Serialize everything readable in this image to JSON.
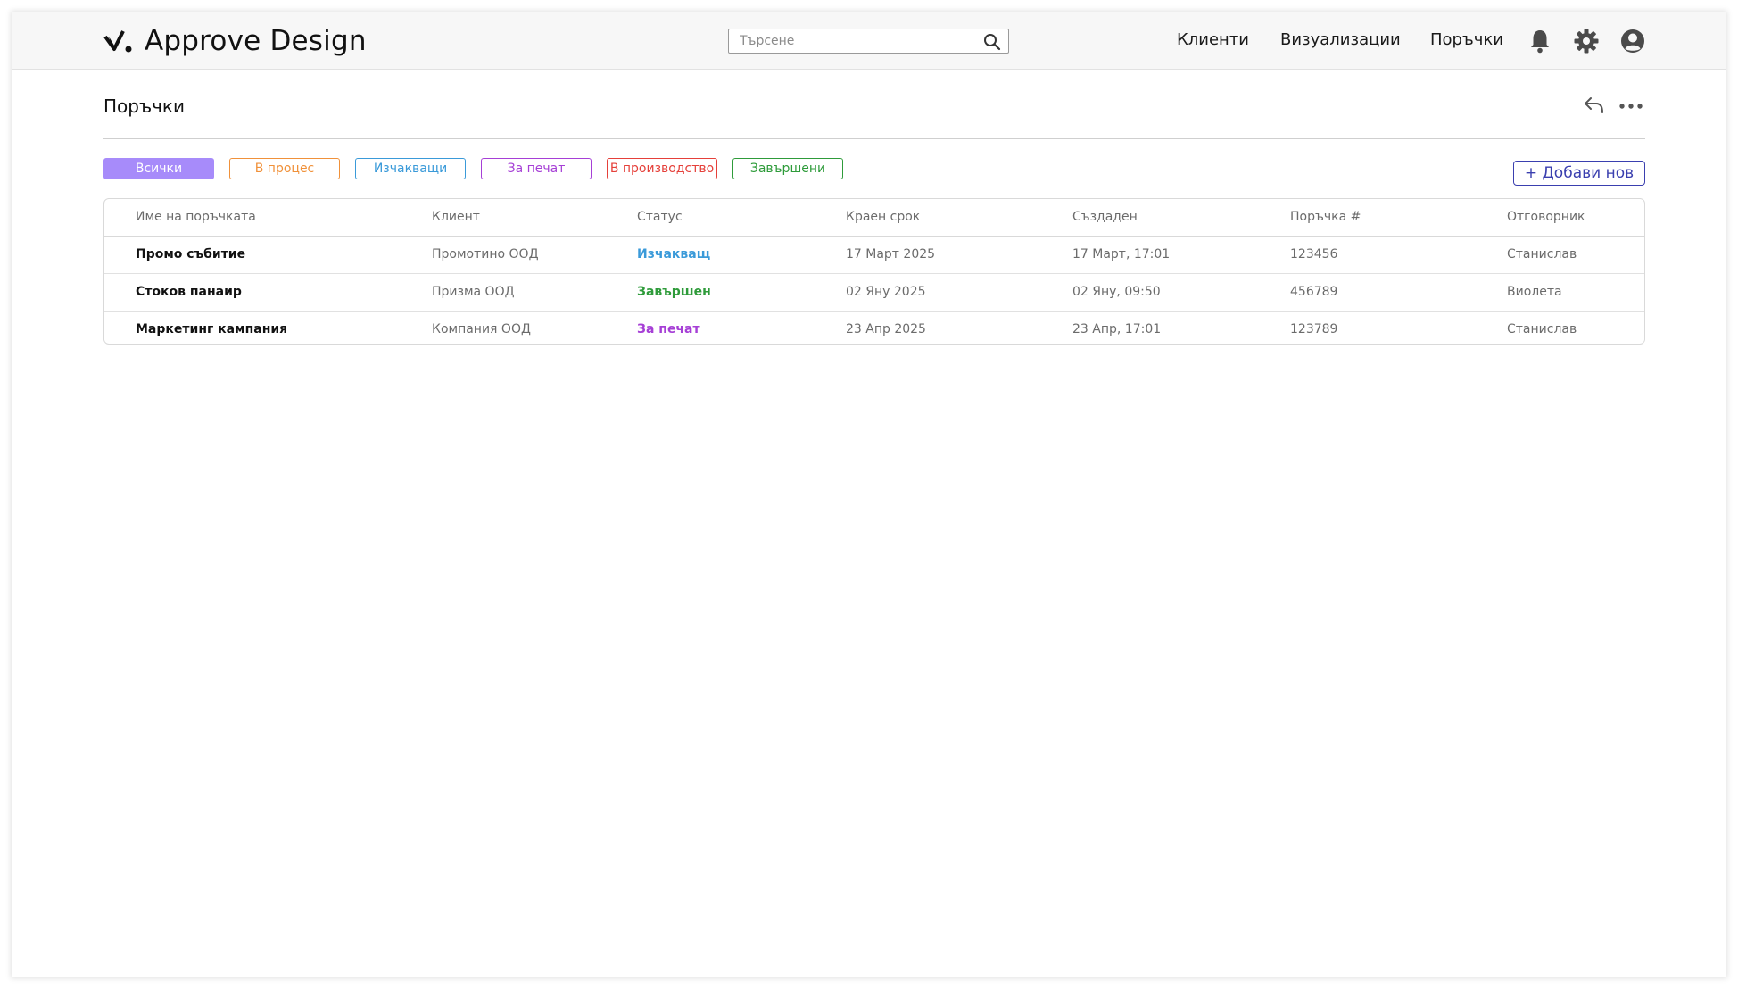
{
  "app": {
    "name": "Approve Design"
  },
  "search": {
    "placeholder": "Търсене"
  },
  "nav": [
    "Клиенти",
    "Визуализации",
    "Поръчки"
  ],
  "page": {
    "title": "Поръчки"
  },
  "filters": [
    {
      "label": "Всички",
      "color": "#a78bfa",
      "active": true
    },
    {
      "label": "В процес",
      "color": "#f0913a",
      "active": false
    },
    {
      "label": "Изчакващи",
      "color": "#3a9ad9",
      "active": false
    },
    {
      "label": "За печат",
      "color": "#a63fd6",
      "active": false
    },
    {
      "label": "В производство",
      "color": "#e5403a",
      "active": false
    },
    {
      "label": "Завършени",
      "color": "#2e9b3a",
      "active": false
    }
  ],
  "add_button": {
    "label": "+ Добави нов"
  },
  "table": {
    "columns": [
      "Име на поръчката",
      "Клиент",
      "Статус",
      "Краен срок",
      "Създаден",
      "Поръчка #",
      "Отговорник"
    ],
    "rows": [
      {
        "name": "Промо събитие",
        "client": "Промотино ООД",
        "status": "Изчакващ",
        "status_color": "#3a9ad9",
        "deadline": "17 Март 2025",
        "created": "17 Март, 17:01",
        "order_no": "123456",
        "owner": "Станислав"
      },
      {
        "name": "Стоков панаир",
        "client": "Призма ООД",
        "status": "Завършен",
        "status_color": "#2e9b3a",
        "deadline": "02 Яну 2025",
        "created": "02 Яну, 09:50",
        "order_no": "456789",
        "owner": "Виолета"
      },
      {
        "name": "Маркетинг кампания",
        "client": "Компания ООД",
        "status": "За печат",
        "status_color": "#a63fd6",
        "deadline": "23 Апр 2025",
        "created": "23 Апр, 17:01",
        "order_no": "123789",
        "owner": "Станислав"
      }
    ]
  },
  "icons": {
    "logo": "checkmark-logo-icon",
    "search": "search-icon",
    "bell": "bell-icon",
    "gear": "gear-icon",
    "user": "user-icon",
    "reply": "reply-icon",
    "more": "more-icon"
  }
}
